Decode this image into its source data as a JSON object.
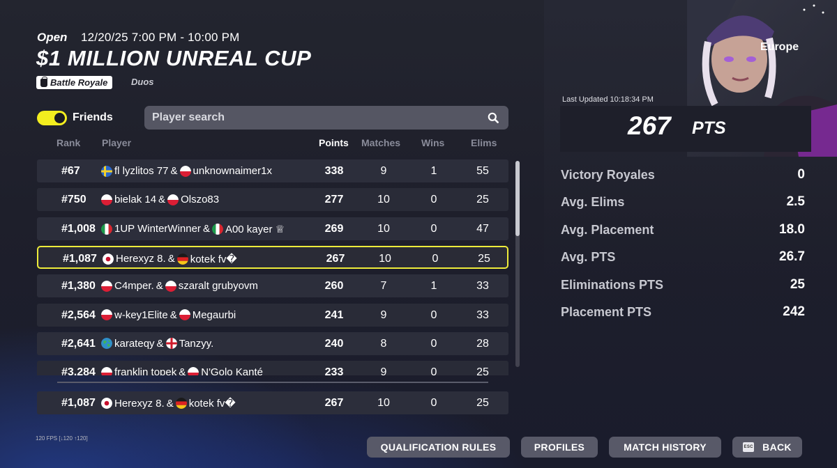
{
  "header": {
    "status": "Open",
    "datetime": "12/20/25 7:00 PM - 10:00 PM",
    "title": "$1 MILLION UNREAL CUP",
    "mode": "Battle Royale",
    "team_type": "Duos"
  },
  "filters": {
    "friends_label": "Friends",
    "friends_on": true,
    "search_placeholder": "Player search"
  },
  "columns": {
    "rank": "Rank",
    "player": "Player",
    "points": "Points",
    "matches": "Matches",
    "wins": "Wins",
    "elims": "Elims"
  },
  "rows": [
    {
      "rank": "#67",
      "p1": "fl lyzlitos 77",
      "p2": "unknownaimer1x",
      "f1": "se",
      "f2": "pl",
      "points": "338",
      "matches": "9",
      "wins": "1",
      "elims": "55"
    },
    {
      "rank": "#750",
      "p1": "bielak 14",
      "p2": "Olszo83",
      "f1": "pl",
      "f2": "pl",
      "points": "277",
      "matches": "10",
      "wins": "0",
      "elims": "25"
    },
    {
      "rank": "#1,008",
      "p1": "1UP WinterWinner",
      "p2": "A00 kayer ♕",
      "f1": "it",
      "f2": "it",
      "points": "269",
      "matches": "10",
      "wins": "0",
      "elims": "47"
    },
    {
      "rank": "#1,087",
      "p1": "Herexyz 8.",
      "p2": "kotek fv�",
      "f1": "jp",
      "f2": "de",
      "points": "267",
      "matches": "10",
      "wins": "0",
      "elims": "25"
    },
    {
      "rank": "#1,380",
      "p1": "C4mper.",
      "p2": "szaralt grubyovm",
      "f1": "pl",
      "f2": "pl",
      "points": "260",
      "matches": "7",
      "wins": "1",
      "elims": "33"
    },
    {
      "rank": "#2,564",
      "p1": "w-key1Elite",
      "p2": "Megaurbi",
      "f1": "pl",
      "f2": "pl",
      "points": "241",
      "matches": "9",
      "wins": "0",
      "elims": "33"
    },
    {
      "rank": "#2,641",
      "p1": "karateqy",
      "p2": "Tanzyy.",
      "f1": "world",
      "f2": "en",
      "points": "240",
      "matches": "8",
      "wins": "0",
      "elims": "28"
    },
    {
      "rank": "#3,284",
      "p1": "franklin topek",
      "p2": "N'Golo Kanté",
      "f1": "pl",
      "f2": "pl",
      "points": "233",
      "matches": "9",
      "wins": "0",
      "elims": "25"
    }
  ],
  "self_row": {
    "rank": "#1,087",
    "p1": "Herexyz 8.",
    "p2": "kotek fv�",
    "f1": "jp",
    "f2": "de",
    "points": "267",
    "matches": "10",
    "wins": "0",
    "elims": "25"
  },
  "highlight_index": 3,
  "panel": {
    "region": "Europe",
    "last_updated": "Last Updated 10:18:34 PM",
    "total_points": "267",
    "points_unit": "PTS",
    "stats": [
      {
        "label": "Victory Royales",
        "value": "0"
      },
      {
        "label": "Avg. Elims",
        "value": "2.5"
      },
      {
        "label": "Avg. Placement",
        "value": "18.0"
      },
      {
        "label": "Avg. PTS",
        "value": "26.7"
      },
      {
        "label": "Eliminations PTS",
        "value": "25"
      },
      {
        "label": "Placement PTS",
        "value": "242"
      }
    ]
  },
  "footer": {
    "fps": "120 FPS [↓120 ↑120]",
    "buttons": {
      "qualification_rules": "QUALIFICATION RULES",
      "profiles": "PROFILES",
      "match_history": "MATCH HISTORY",
      "back": "BACK",
      "esc": "ESC"
    }
  },
  "colors": {
    "accent_yellow": "#f3ee1f",
    "highlight_border": "#eeec3a",
    "row_bg": "#2c2e3b",
    "button_bg": "#585968"
  }
}
